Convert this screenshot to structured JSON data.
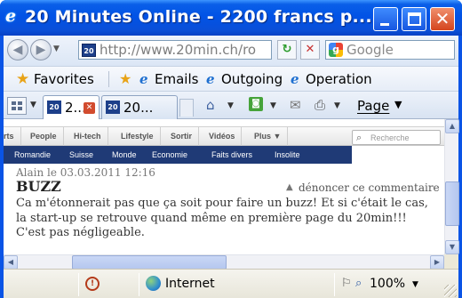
{
  "window": {
    "title": "20 Minutes Online - 2200 francs p...",
    "minimize_glyph": "",
    "close_glyph": "✕"
  },
  "address_bar": {
    "url": "http://www.20min.ch/ro",
    "back_glyph": "◀",
    "forward_glyph": "▶",
    "site_icon_text": "20",
    "refresh_glyph": "↻",
    "stop_glyph": "✕"
  },
  "search": {
    "placeholder": "Google",
    "icon_letter": "g"
  },
  "favorites_bar": {
    "favorites_label": "Favorites",
    "links": [
      {
        "label": "Emails",
        "icon": "ie-page-icon"
      },
      {
        "label": "Outgoing",
        "icon": "ie-page-icon"
      },
      {
        "label": "Operation",
        "icon": "ie-page-icon"
      }
    ]
  },
  "tabs": [
    {
      "label": "2...",
      "icon_text": "20",
      "active": true
    },
    {
      "label": "20...",
      "icon_text": "20",
      "active": false
    }
  ],
  "command_bar": {
    "page_label": "Page"
  },
  "site": {
    "nav_top": [
      "rts",
      "People",
      "Hi-tech",
      "Lifestyle",
      "Sortir",
      "Vidéos",
      "Plus ▼"
    ],
    "search_placeholder": "Recherche",
    "nav_sections": [
      "Romandie",
      "Suisse",
      "Monde",
      "Economie",
      "Faits divers",
      "Insolite"
    ],
    "accent_color": "#1f3a76"
  },
  "comment": {
    "meta": "Alain le 03.03.2011 12:16",
    "title": "BUZZ",
    "report_label": "dénoncer ce commentaire",
    "body": "Ca m'étonnerait pas que ça soit pour faire un buzz! Et si c'était le cas, la start-up se retrouve quand même en première page du 20min!!! C'est pas négligeable."
  },
  "status_bar": {
    "zone": "Internet",
    "zoom": "100%"
  }
}
